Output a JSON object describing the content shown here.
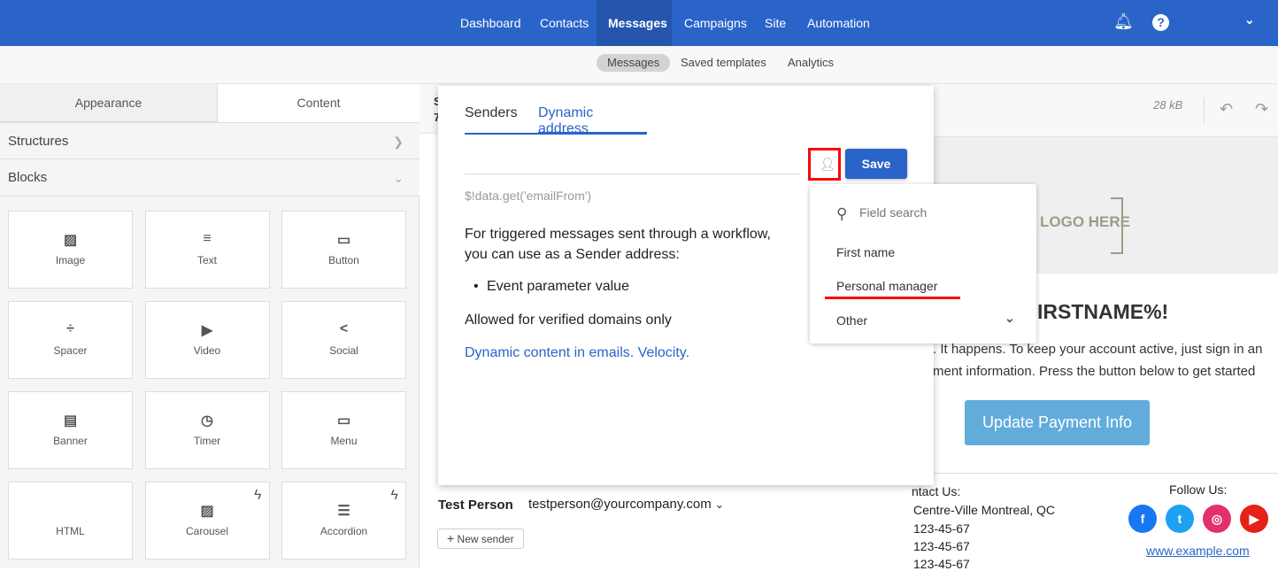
{
  "nav": {
    "items": [
      "Dashboard",
      "Contacts",
      "Messages",
      "Campaigns",
      "Site",
      "Automation"
    ],
    "active": "Messages",
    "icons": [
      "bell-icon",
      "help-icon",
      "chevron-down-icon"
    ]
  },
  "subnav": {
    "items": [
      "Messages",
      "Saved templates",
      "Analytics"
    ],
    "active": "Messages"
  },
  "left": {
    "tabs": [
      "Appearance",
      "Content"
    ],
    "active_tab": "Content",
    "structures": "Structures",
    "blocks_label": "Blocks",
    "blocks": [
      {
        "label": "Image",
        "icon": "image-icon"
      },
      {
        "label": "Text",
        "icon": "text-icon"
      },
      {
        "label": "Button",
        "icon": "button-icon"
      },
      {
        "label": "Spacer",
        "icon": "spacer-icon"
      },
      {
        "label": "Video",
        "icon": "video-icon"
      },
      {
        "label": "Social",
        "icon": "share-icon"
      },
      {
        "label": "Banner",
        "icon": "banner-icon"
      },
      {
        "label": "Timer",
        "icon": "timer-icon"
      },
      {
        "label": "Menu",
        "icon": "menu-icon"
      },
      {
        "label": "HTML",
        "icon": "code-icon"
      },
      {
        "label": "Carousel",
        "icon": "carousel-icon",
        "bolt": true
      },
      {
        "label": "Accordion",
        "icon": "accordion-icon",
        "bolt": true
      }
    ]
  },
  "mid": {
    "partial_top1": "S",
    "partial_top2": "7",
    "sender_name": "Test Person",
    "sender_email": "testperson@yourcompany.com",
    "new_sender": "New sender"
  },
  "popup": {
    "tabs": [
      "Senders",
      "Dynamic address"
    ],
    "active_tab": "Dynamic address",
    "input_value": "",
    "save": "Save",
    "hint": "$!data.get('emailFrom')",
    "desc": "For triggered messages sent through a workflow, you can use as a Sender address:",
    "bullet": "Event parameter value",
    "allowed": "Allowed for verified domains only",
    "link": "Dynamic content in emails. Velocity."
  },
  "dropdown": {
    "search_placeholder": "Field search",
    "items": [
      "First name",
      "Personal manager"
    ],
    "other": "Other"
  },
  "preview": {
    "size": "28 kB",
    "logo": "LOGO HERE",
    "greeting": "IRSTNAME%!",
    "body1": ". It happens. To keep your account active, just sign in an",
    "body2": "ment information. Press the button below to get started",
    "cta": "Update Payment Info",
    "contact_title": "ntact Us:",
    "address": "Centre-Ville Montreal, QC",
    "phones": [
      "123-45-67",
      "123-45-67",
      "123-45-67"
    ],
    "follow": "Follow Us:",
    "website": "www.example.com",
    "socials": [
      {
        "name": "facebook",
        "color": "#1877f2",
        "glyph": "f"
      },
      {
        "name": "twitter",
        "color": "#1da1f2",
        "glyph": "t"
      },
      {
        "name": "instagram",
        "color": "#e1306c",
        "glyph": "◎"
      },
      {
        "name": "youtube",
        "color": "#e62117",
        "glyph": "▶"
      }
    ]
  },
  "colors": {
    "brand": "#2b64c9",
    "accent_link": "#2b64c9",
    "cta": "#62acdc",
    "highlight": "#ff0000"
  }
}
